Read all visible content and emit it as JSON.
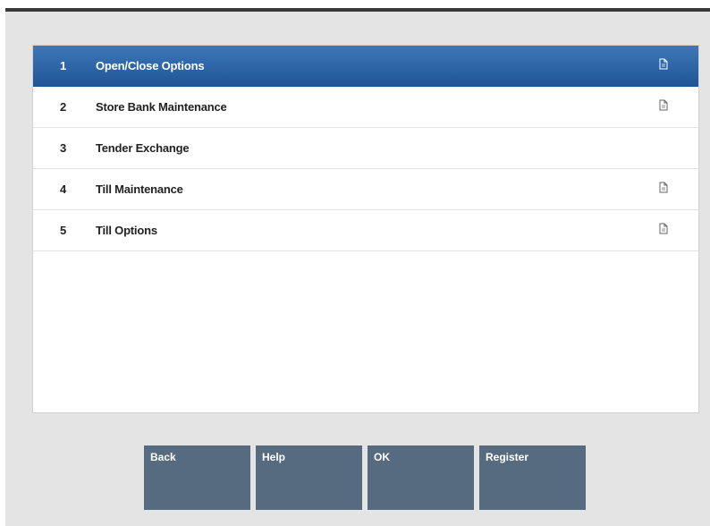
{
  "menu": {
    "items": [
      {
        "number": "1",
        "label": "Open/Close Options",
        "has_submenu_icon": true,
        "selected": true
      },
      {
        "number": "2",
        "label": "Store Bank Maintenance",
        "has_submenu_icon": true,
        "selected": false
      },
      {
        "number": "3",
        "label": "Tender Exchange",
        "has_submenu_icon": false,
        "selected": false
      },
      {
        "number": "4",
        "label": "Till Maintenance",
        "has_submenu_icon": true,
        "selected": false
      },
      {
        "number": "5",
        "label": "Till Options",
        "has_submenu_icon": true,
        "selected": false
      }
    ],
    "icon_name": "submenu-document-icon"
  },
  "buttons": {
    "back": "Back",
    "help": "Help",
    "ok": "OK",
    "register": "Register"
  },
  "colors": {
    "selected_row": "#2a64a6",
    "button_bg": "#566a80",
    "frame_bg": "#e4e4e4",
    "top_border": "#3a3a3a"
  }
}
